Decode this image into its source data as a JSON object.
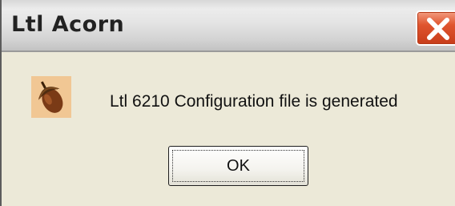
{
  "window": {
    "title": "Ltl Acorn",
    "close_icon": "close-x-icon"
  },
  "message": {
    "icon": "acorn-icon",
    "text": "Ltl 6210 Configuration file is generated"
  },
  "buttons": {
    "ok_label": "OK"
  },
  "colors": {
    "close_button": "#e0552f",
    "dialog_background": "#ece9d8"
  }
}
